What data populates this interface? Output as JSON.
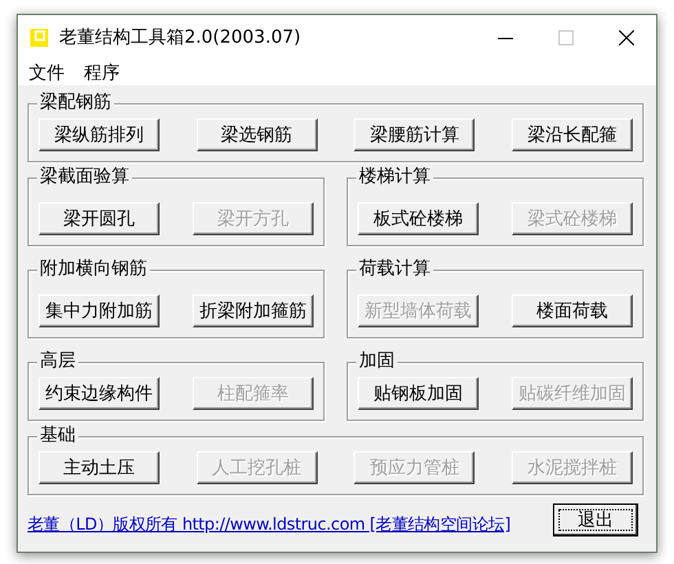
{
  "window": {
    "title": "老董结构工具箱2.0(2003.07)",
    "maximize_disabled": true
  },
  "menu": [
    {
      "label": "文件"
    },
    {
      "label": "程序"
    }
  ],
  "rows": [
    {
      "groups": [
        {
          "title": "梁配钢筋",
          "buttons": [
            {
              "label": "梁纵筋排列",
              "disabled": false
            },
            {
              "label": "梁选钢筋",
              "disabled": false
            },
            {
              "label": "梁腰筋计算",
              "disabled": false
            },
            {
              "label": "梁沿长配箍",
              "disabled": false
            }
          ]
        }
      ]
    },
    {
      "groups": [
        {
          "title": "梁截面验算",
          "buttons": [
            {
              "label": "梁开圆孔",
              "disabled": false
            },
            {
              "label": "梁开方孔",
              "disabled": true
            }
          ]
        },
        {
          "title": "楼梯计算",
          "buttons": [
            {
              "label": "板式砼楼梯",
              "disabled": false
            },
            {
              "label": "梁式砼楼梯",
              "disabled": true
            }
          ]
        }
      ]
    },
    {
      "groups": [
        {
          "title": "附加横向钢筋",
          "buttons": [
            {
              "label": "集中力附加筋",
              "disabled": false
            },
            {
              "label": "折梁附加箍筋",
              "disabled": false
            }
          ]
        },
        {
          "title": "荷载计算",
          "buttons": [
            {
              "label": "新型墙体荷载",
              "disabled": true
            },
            {
              "label": "楼面荷载",
              "disabled": false
            }
          ]
        }
      ]
    },
    {
      "groups": [
        {
          "title": "高层",
          "buttons": [
            {
              "label": "约束边缘构件",
              "disabled": false
            },
            {
              "label": "柱配箍率",
              "disabled": true
            }
          ]
        },
        {
          "title": "加固",
          "buttons": [
            {
              "label": "贴钢板加固",
              "disabled": false
            },
            {
              "label": "贴碳纤维加固",
              "disabled": true
            }
          ]
        }
      ]
    },
    {
      "groups": [
        {
          "title": "基础",
          "buttons": [
            {
              "label": "主动土压",
              "disabled": false
            },
            {
              "label": "人工挖孔桩",
              "disabled": true
            },
            {
              "label": "预应力管桩",
              "disabled": true
            },
            {
              "label": "水泥搅拌桩",
              "disabled": true
            }
          ]
        }
      ]
    }
  ],
  "footer": {
    "link": "老董（LD）版权所有 http://www.ldstruc.com [老董结构空间论坛]",
    "exit_button": {
      "label": "退出",
      "focused": true
    }
  }
}
